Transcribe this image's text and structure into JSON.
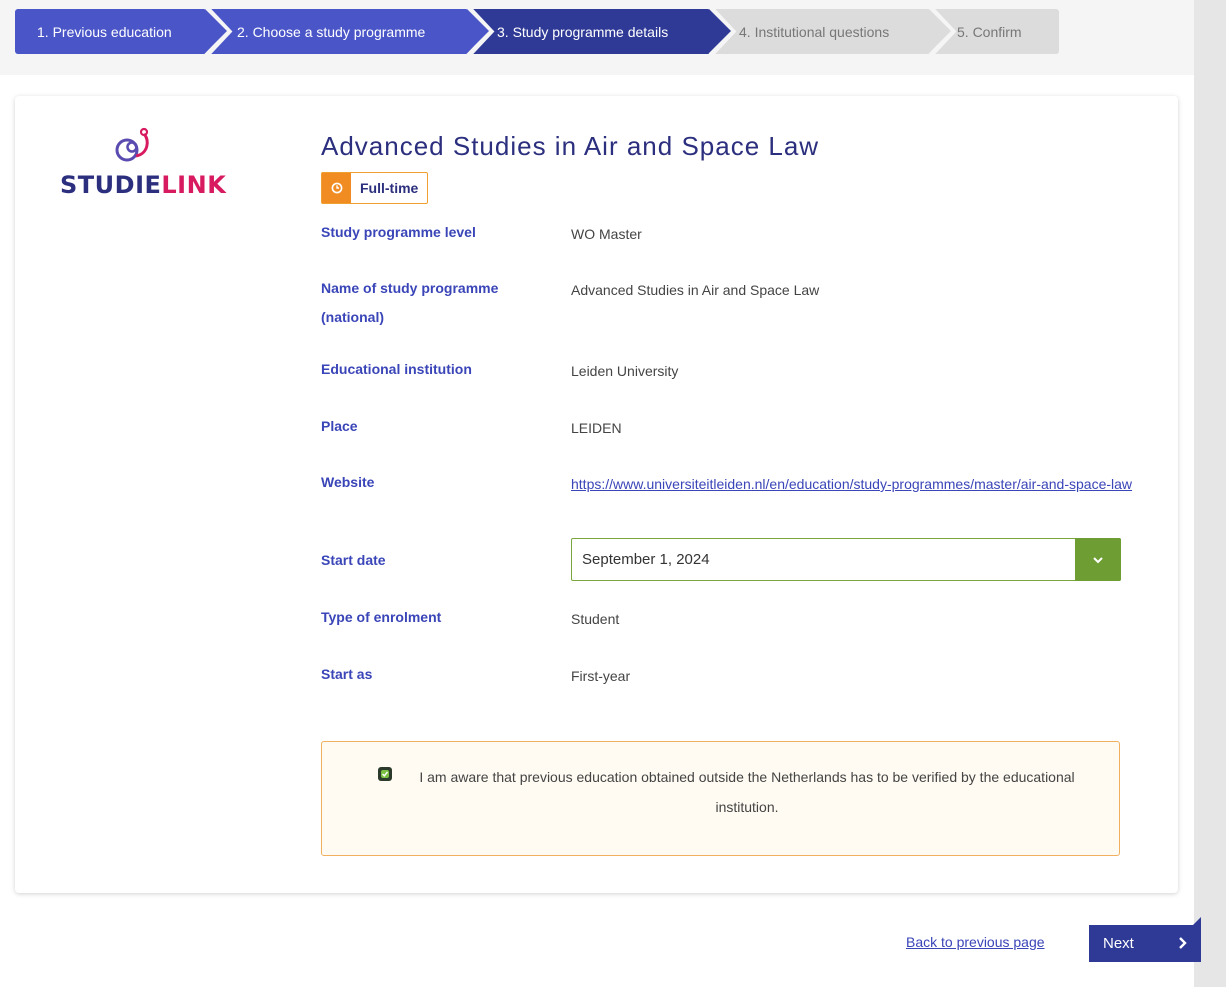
{
  "steps": [
    {
      "label": "1. Previous education"
    },
    {
      "label": "2. Choose a study programme"
    },
    {
      "label": "3. Study programme details"
    },
    {
      "label": "4. Institutional questions"
    },
    {
      "label": "5. Confirm"
    }
  ],
  "logo": {
    "text_a": "STUDIE",
    "text_b": "LINK"
  },
  "programme": {
    "title": "Advanced Studies in Air and Space Law",
    "badge": "Full-time"
  },
  "fields": {
    "level_label": "Study programme level",
    "level_value": "WO Master",
    "name_label": "Name of study programme (national)",
    "name_value": "Advanced Studies in Air and Space Law",
    "institution_label": "Educational institution",
    "institution_value": "Leiden University",
    "place_label": "Place",
    "place_value": "LEIDEN",
    "website_label": "Website",
    "website_value": "https://www.universiteitleiden.nl/en/education/study-programmes/master/air-and-space-law",
    "start_date_label": "Start date",
    "start_date_value": "September 1, 2024",
    "enrolment_label": "Type of enrolment",
    "enrolment_value": "Student",
    "start_as_label": "Start as",
    "start_as_value": "First-year"
  },
  "notice": {
    "text": "I am aware that previous education obtained outside the Netherlands has to be verified by the educational institution.",
    "checked": true
  },
  "footer": {
    "back_label": "Back to previous page",
    "next_label": "Next"
  },
  "colors": {
    "primary": "#4a55c8",
    "primary_dark": "#2f3a96",
    "accent_orange": "#f08c22",
    "select_green": "#6e9e33"
  }
}
